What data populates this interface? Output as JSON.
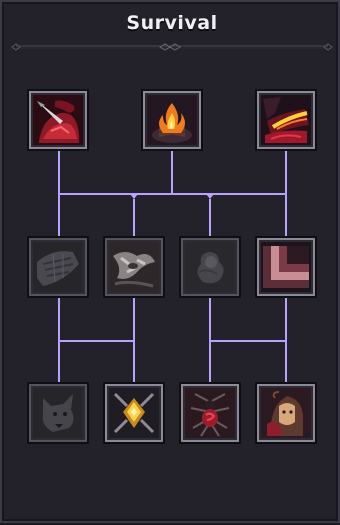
{
  "panel": {
    "title": "Survival"
  },
  "colors": {
    "connector": "#b9a2ff",
    "frame_unlocked": "#8d8a97",
    "frame_locked": "#55535e",
    "background": "#23212a"
  },
  "skills": [
    {
      "icon": "bleeding-wound-icon",
      "state": "unlocked"
    },
    {
      "icon": "campfire-icon",
      "state": "unlocked"
    },
    {
      "icon": "burning-cloak-icon",
      "state": "unlocked"
    },
    {
      "icon": "torn-cloth-icon",
      "state": "locked"
    },
    {
      "icon": "bone-fragments-icon",
      "state": "locked"
    },
    {
      "icon": "smoke-spirit-icon",
      "state": "locked"
    },
    {
      "icon": "layered-armor-icon",
      "state": "unlocked"
    },
    {
      "icon": "wolf-head-icon",
      "state": "locked"
    },
    {
      "icon": "glowing-crystal-icon",
      "state": "unlocked"
    },
    {
      "icon": "blood-spider-icon",
      "state": "unlocked"
    },
    {
      "icon": "hooded-figure-icon",
      "state": "unlocked"
    }
  ]
}
